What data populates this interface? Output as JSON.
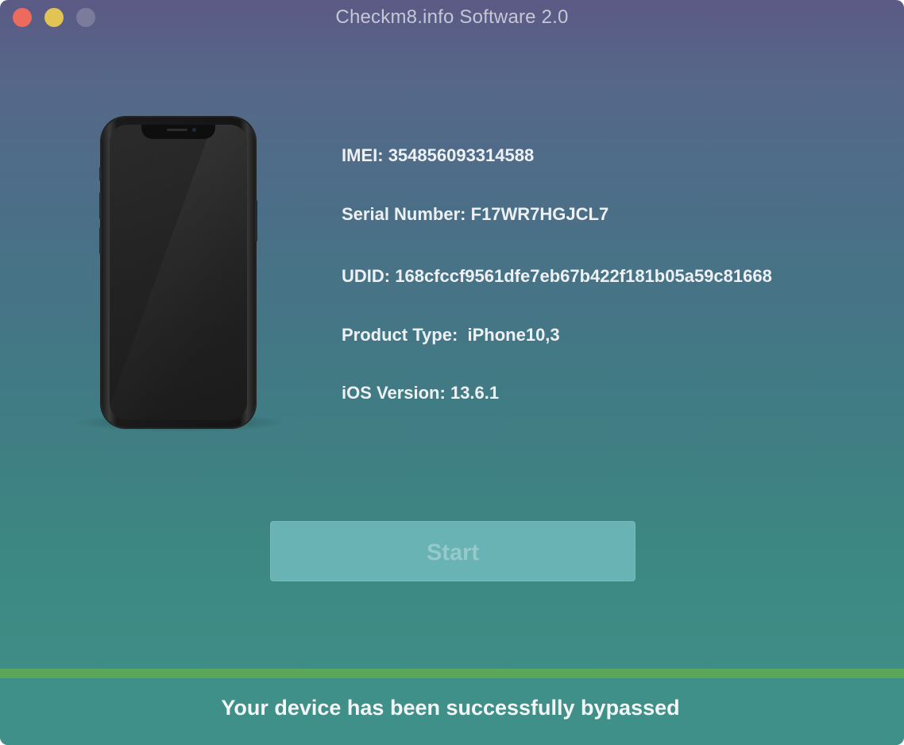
{
  "window": {
    "title": "Checkm8.info Software 2.0"
  },
  "device": {
    "imei_label": "IMEI:",
    "imei_value": "354856093314588",
    "serial_label": "Serial Number:",
    "serial_value": "F17WR7HGJCL7",
    "udid_label": "UDID:",
    "udid_value": "168cfccf9561dfe7eb67b422f181b05a59c81668",
    "product_label": "Product Type:",
    "product_value": "iPhone10,3",
    "ios_label": "iOS Version:",
    "ios_value": "13.6.1"
  },
  "actions": {
    "start_label": "Start"
  },
  "progress": {
    "fraction": 1.0,
    "color": "#5aa75a"
  },
  "status": {
    "message": "Your device has been successfully bypassed"
  },
  "icons": {
    "close": "close-icon",
    "minimize": "minimize-icon",
    "zoom": "zoom-icon",
    "device": "iphone-illustration"
  },
  "colors": {
    "close": "#ec6a5e",
    "minimize": "#e1c454",
    "zoom_inactive": "#7b7c9c",
    "button_bg": "#6ab3b5",
    "button_text": "#95c9cb"
  }
}
